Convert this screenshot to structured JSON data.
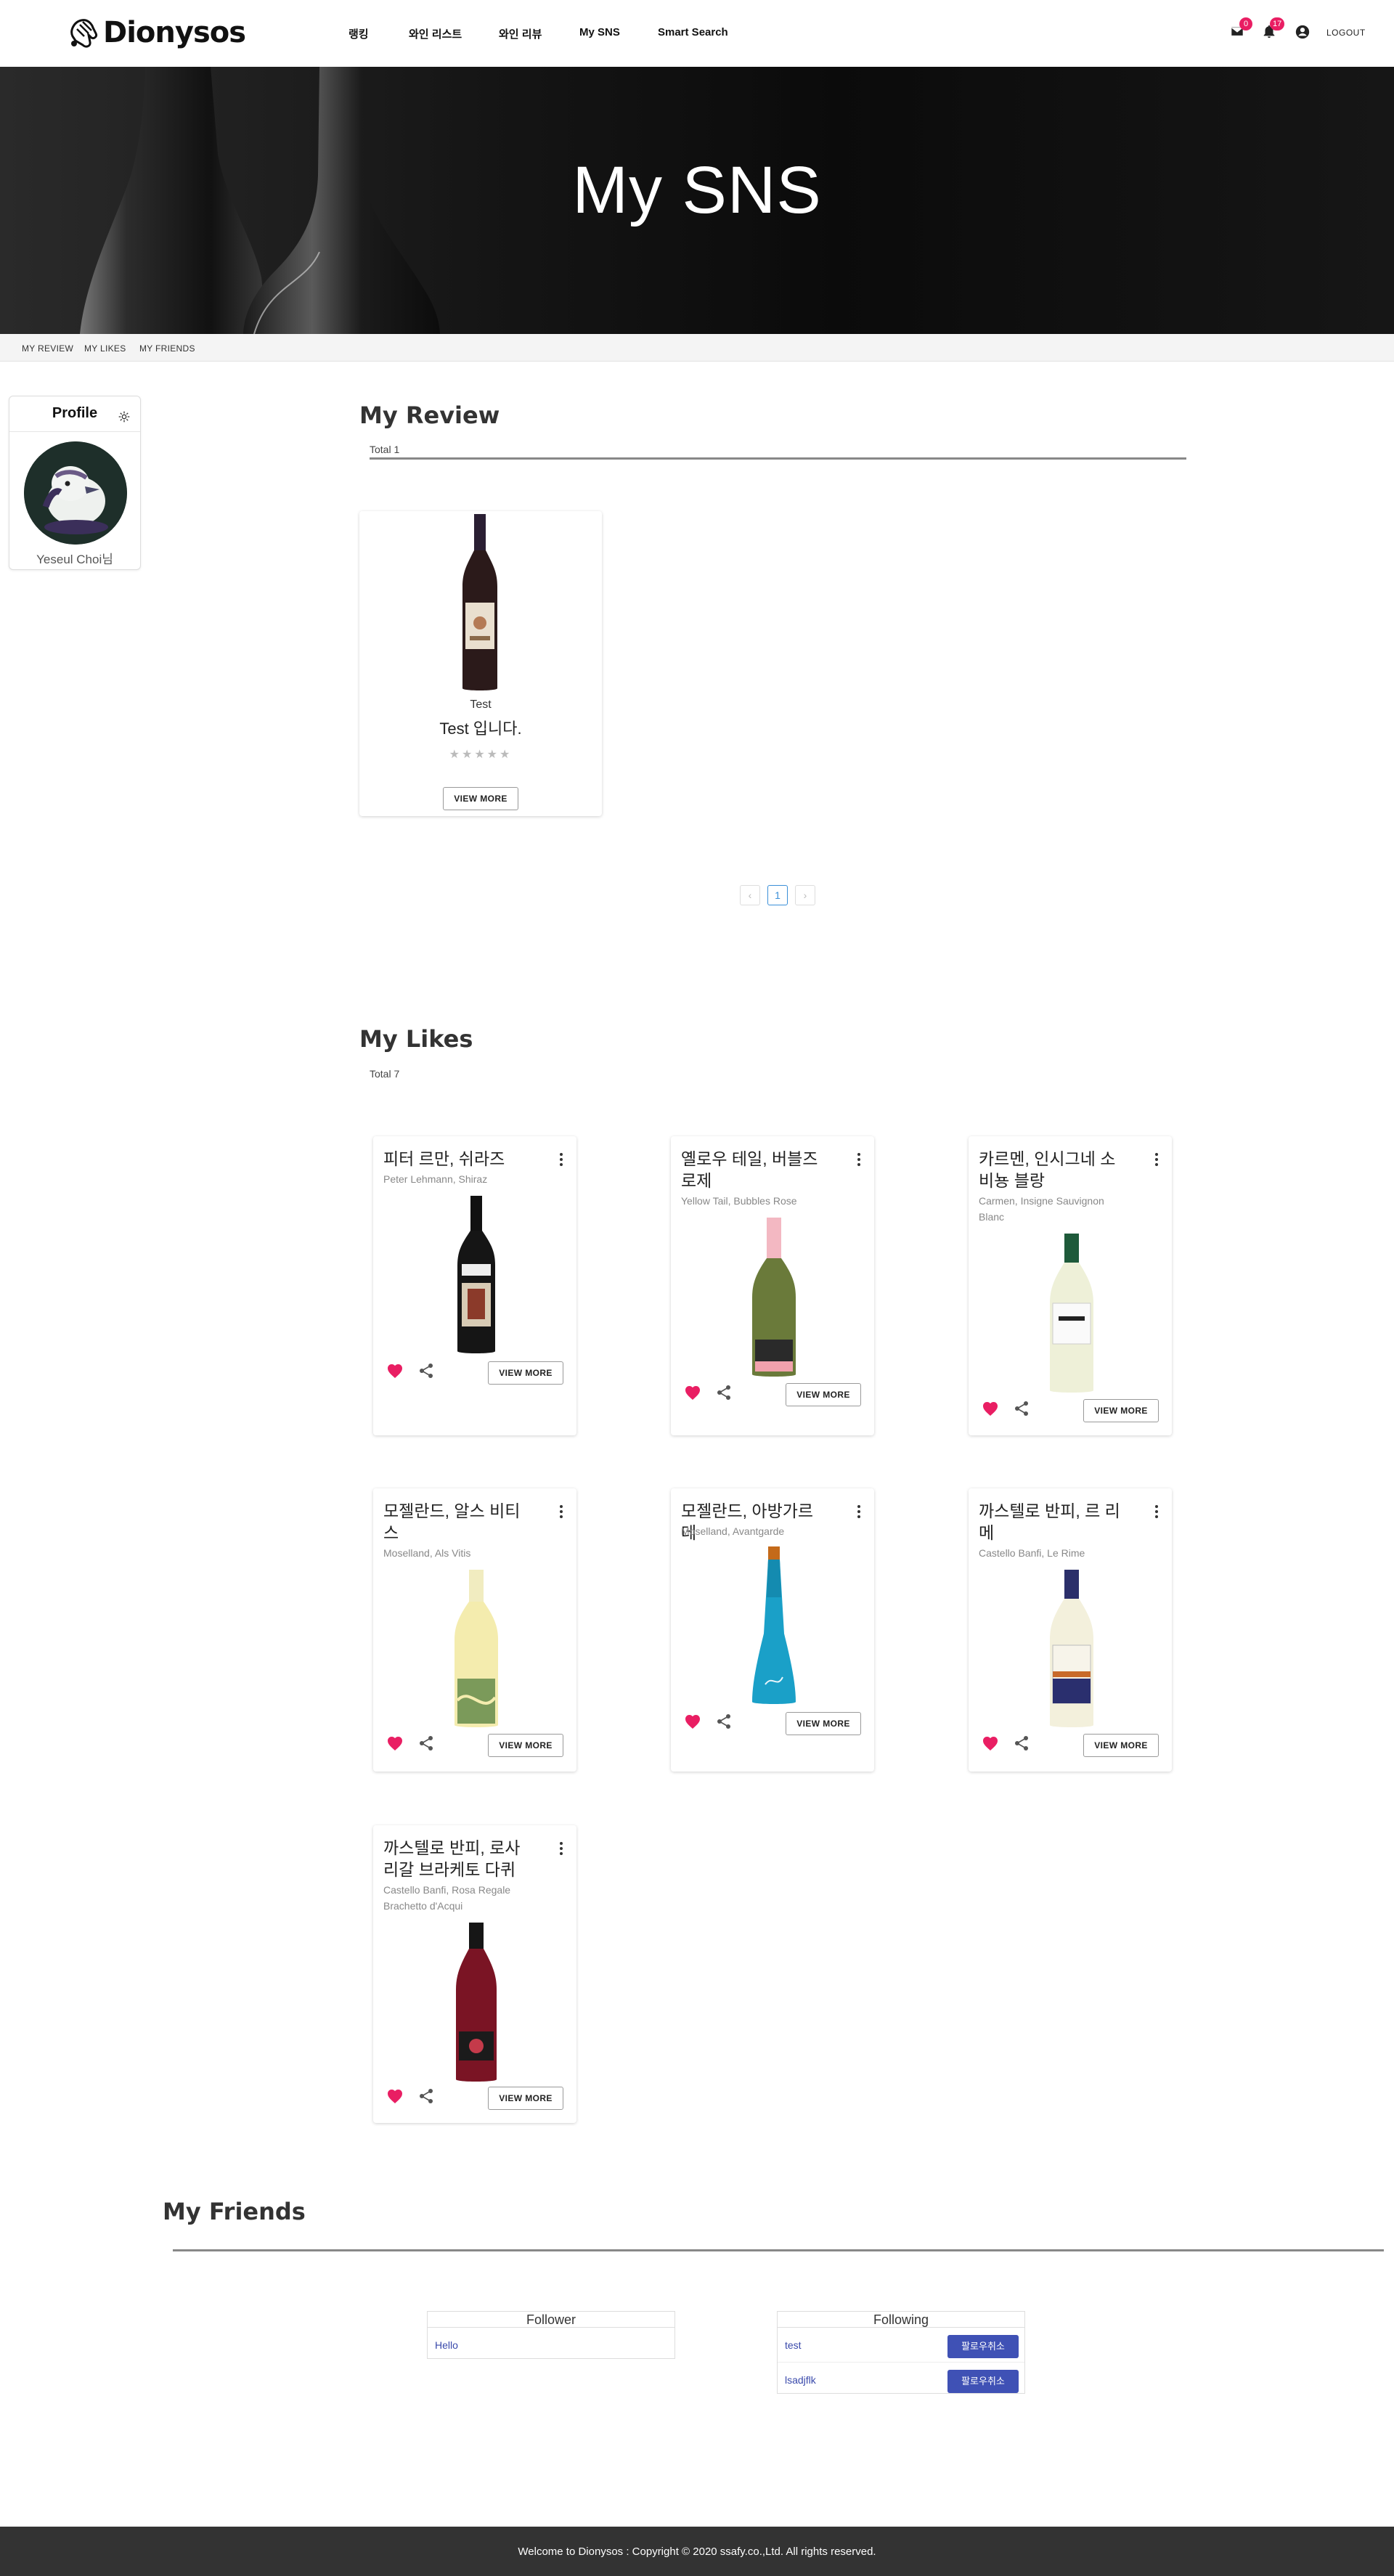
{
  "header": {
    "brand": "Dionysos",
    "nav": [
      "랭킹",
      "와인 리스트",
      "와인 리뷰",
      "My SNS",
      "Smart Search"
    ],
    "mail_count": "0",
    "notification_count": "17",
    "logout_label": "LOGOUT",
    "icons": [
      "logo-hand-icon",
      "mail-icon",
      "bell-icon",
      "account-circle-icon"
    ]
  },
  "hero": {
    "title": "My SNS"
  },
  "subnav": [
    "MY REVIEW",
    "MY LIKES",
    "MY FRIENDS"
  ],
  "profile": {
    "title": "Profile",
    "name": "Yeseul Choi님"
  },
  "my_review": {
    "title": "My Review",
    "total": "Total 1",
    "cards": [
      {
        "wine_name": "Test",
        "review": "Test 입니다.",
        "stars": "★★★★★",
        "rating": 0,
        "button": "VIEW MORE"
      }
    ],
    "pagination": {
      "prev": "‹",
      "current": "1",
      "next": "›"
    }
  },
  "my_likes": {
    "title": "My Likes",
    "total": "Total 7",
    "button_label": "VIEW MORE",
    "cards": [
      {
        "title": "피터 르만, 쉬라즈",
        "subtitle": "Peter Lehmann, Shiraz"
      },
      {
        "title": "옐로우 테일, 버블즈 로제",
        "subtitle": "Yellow Tail, Bubbles Rose"
      },
      {
        "title": "카르멘, 인시그네 소비뇽 블랑",
        "subtitle": "Carmen, Insigne Sauvignon Blanc"
      },
      {
        "title": "모젤란드, 알스 비티스",
        "subtitle": "Moselland, Als Vitis"
      },
      {
        "title": "모젤란드, 아방가르데",
        "subtitle": "Moselland, Avantgarde"
      },
      {
        "title": "까스텔로 반피, 르 리메",
        "subtitle": "Castello Banfi, Le Rime"
      },
      {
        "title": "까스텔로 반피, 로사 리갈 브라케토 다퀴",
        "subtitle": "Castello Banfi, Rosa Regale Brachetto d'Acqui"
      }
    ]
  },
  "my_friends": {
    "title": "My Friends",
    "follower_title": "Follower",
    "followers": [
      "Hello"
    ],
    "following_title": "Following",
    "following": [
      "test",
      "lsadjflk"
    ],
    "unfollow_label": "팔로우취소"
  },
  "footer": {
    "text": "Welcome to Dionysos : Copyright © 2020 ssafy.co.,Ltd. All rights reserved."
  },
  "colors": {
    "accent": "#e91e63",
    "indigo": "#3f51b5",
    "footer_bg": "#333333"
  }
}
